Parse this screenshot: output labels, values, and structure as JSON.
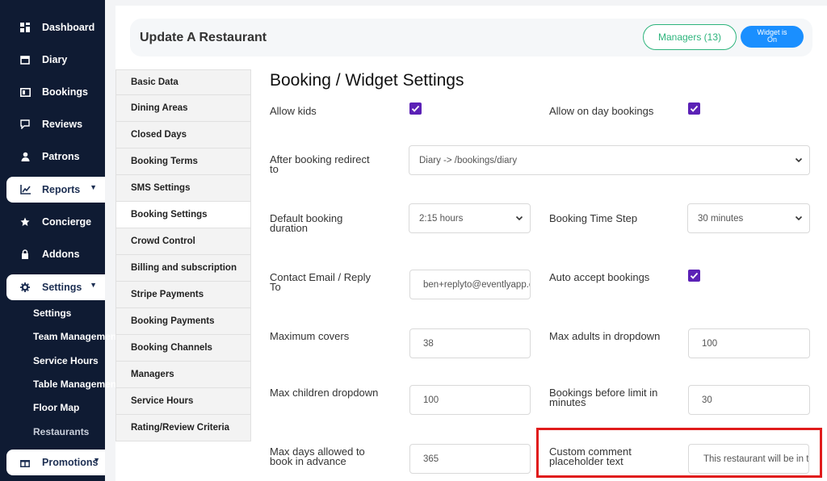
{
  "sidebar": {
    "items": [
      {
        "label": "Dashboard",
        "icon": "dashboard-icon"
      },
      {
        "label": "Diary",
        "icon": "calendar-icon"
      },
      {
        "label": "Bookings",
        "icon": "bookings-icon"
      },
      {
        "label": "Reviews",
        "icon": "reviews-icon"
      },
      {
        "label": "Patrons",
        "icon": "user-icon"
      },
      {
        "label": "Reports",
        "icon": "chart-icon"
      },
      {
        "label": "Concierge",
        "icon": "star-icon"
      },
      {
        "label": "Addons",
        "icon": "addons-icon"
      },
      {
        "label": "Settings",
        "icon": "gear-icon"
      },
      {
        "label": "Promotions",
        "icon": "gift-icon"
      }
    ],
    "settings_sub": [
      "Settings",
      "Team Management",
      "Service Hours",
      "Table Management",
      "Floor Map",
      "Restaurants"
    ]
  },
  "header": {
    "title": "Update A Restaurant",
    "managers_label": "Managers (13)",
    "widget_line1": "Widget is",
    "widget_line2": "On"
  },
  "menu": {
    "items": [
      "Basic Data",
      "Dining Areas",
      "Closed Days",
      "Booking Terms",
      "SMS Settings",
      "Booking Settings",
      "Crowd Control",
      "Billing and subscription",
      "Stripe Payments",
      "Booking Payments",
      "Booking Channels",
      "Managers",
      "Service Hours",
      "Rating/Review Criteria"
    ],
    "active": "Booking Settings"
  },
  "form": {
    "section_title": "Booking / Widget Settings",
    "allow_kids_label": "Allow kids",
    "allow_kids": true,
    "allow_on_day_label": "Allow on day bookings",
    "allow_on_day": true,
    "redirect_label_1": "After booking redirect",
    "redirect_label_2": "to",
    "redirect_value": "Diary -> /bookings/diary",
    "duration_label_1": "Default booking",
    "duration_label_2": "duration",
    "duration_value": "2:15 hours",
    "time_step_label": "Booking Time Step",
    "time_step_value": "30 minutes",
    "email_label_1": "Contact Email / Reply",
    "email_label_2": "To",
    "email_value": "ben+replyto@eventlyapp.com",
    "auto_accept_label": "Auto accept bookings",
    "auto_accept": true,
    "max_covers_label": "Maximum covers",
    "max_covers_value": "38",
    "max_adults_label": "Max adults in dropdown",
    "max_adults_value": "100",
    "max_children_label": "Max children dropdown",
    "max_children_value": "100",
    "limit_label_1": "Bookings before limit in",
    "limit_label_2": "minutes",
    "limit_value": "30",
    "max_days_label_1": "Max days allowed to",
    "max_days_label_2": "book in advance",
    "max_days_value": "365",
    "comment_label_1": "Custom comment",
    "comment_label_2": "placeholder text",
    "comment_value": "This restaurant will be in touch"
  },
  "colors": {
    "sidebar_bg": "#0f1b33",
    "checkbox": "#5b21b6",
    "managers_green": "#2db47c",
    "widget_blue": "#1a8fff",
    "highlight_red": "#e01b1b"
  }
}
